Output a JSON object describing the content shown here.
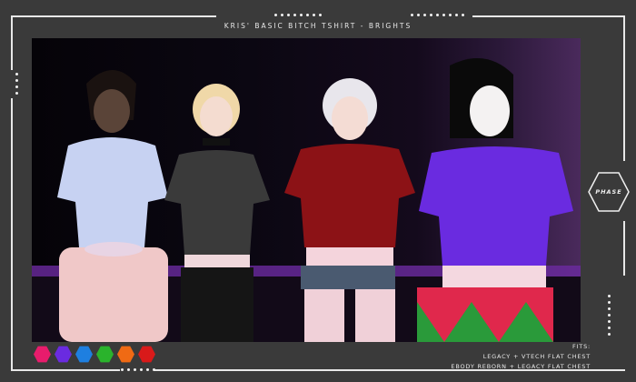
{
  "header": {
    "title": "KRIS' BASIC BITCH TSHIRT - BRIGHTS"
  },
  "badge": {
    "label": "PHASE"
  },
  "swatches": [
    {
      "name": "pink",
      "color": "#e81c6c"
    },
    {
      "name": "purple",
      "color": "#6a2be0"
    },
    {
      "name": "blue",
      "color": "#1e7fe0"
    },
    {
      "name": "green",
      "color": "#2ab32c"
    },
    {
      "name": "orange",
      "color": "#f06a14"
    },
    {
      "name": "red",
      "color": "#d91a1a"
    }
  ],
  "fits": {
    "line1": "FITS:",
    "line2": "LEGACY + VTECH FLAT CHEST",
    "line3": "EBODY REBORN + LEGACY FLAT CHEST"
  },
  "models": [
    {
      "shirt_color": "#c7d2f2"
    },
    {
      "shirt_color": "#3a3a3a"
    },
    {
      "shirt_color": "#8c1216"
    },
    {
      "shirt_color": "#6a2be0"
    }
  ]
}
